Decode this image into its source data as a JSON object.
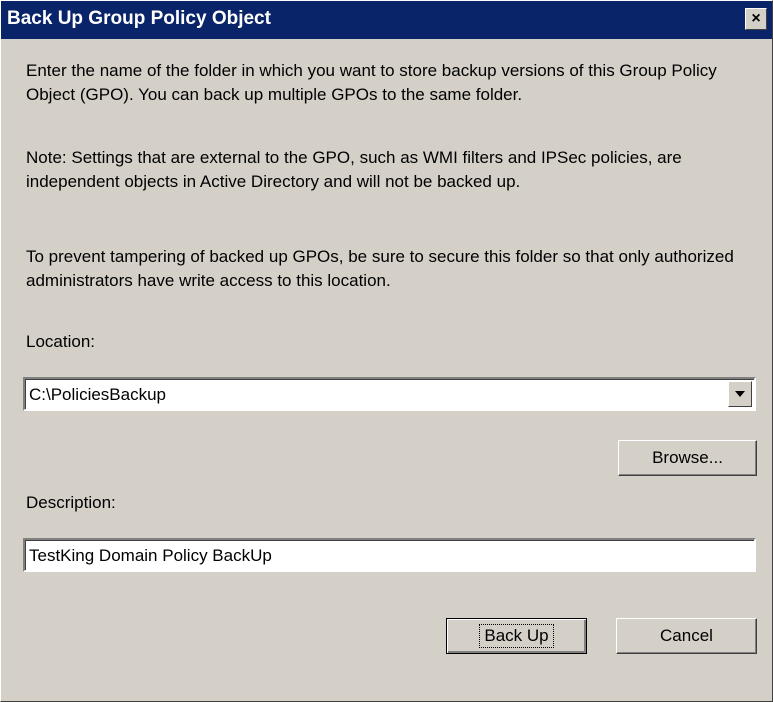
{
  "window": {
    "title": "Back Up Group Policy Object",
    "close_icon": "close-icon",
    "close_glyph": "×"
  },
  "instructions": {
    "intro": "Enter the name of the folder in which you want to store backup versions of this Group Policy Object (GPO). You can back up multiple GPOs to the same folder.",
    "note": "Note: Settings that are external to the GPO, such as WMI filters and IPSec policies, are independent objects in Active Directory and will not be backed up.",
    "security": "To prevent tampering of backed up GPOs, be sure to secure this folder so that only authorized administrators have write access to this location."
  },
  "location": {
    "label": "Location:",
    "value": "C:\\PoliciesBackup",
    "dropdown_icon": "chevron-down-icon"
  },
  "browse_button": {
    "label": "Browse..."
  },
  "description": {
    "label": "Description:",
    "value": "TestKing Domain Policy BackUp"
  },
  "actions": {
    "backup_label": "Back Up",
    "cancel_label": "Cancel"
  },
  "colors": {
    "titlebar": "#0a246a",
    "dialog_face": "#d4d0c8"
  }
}
